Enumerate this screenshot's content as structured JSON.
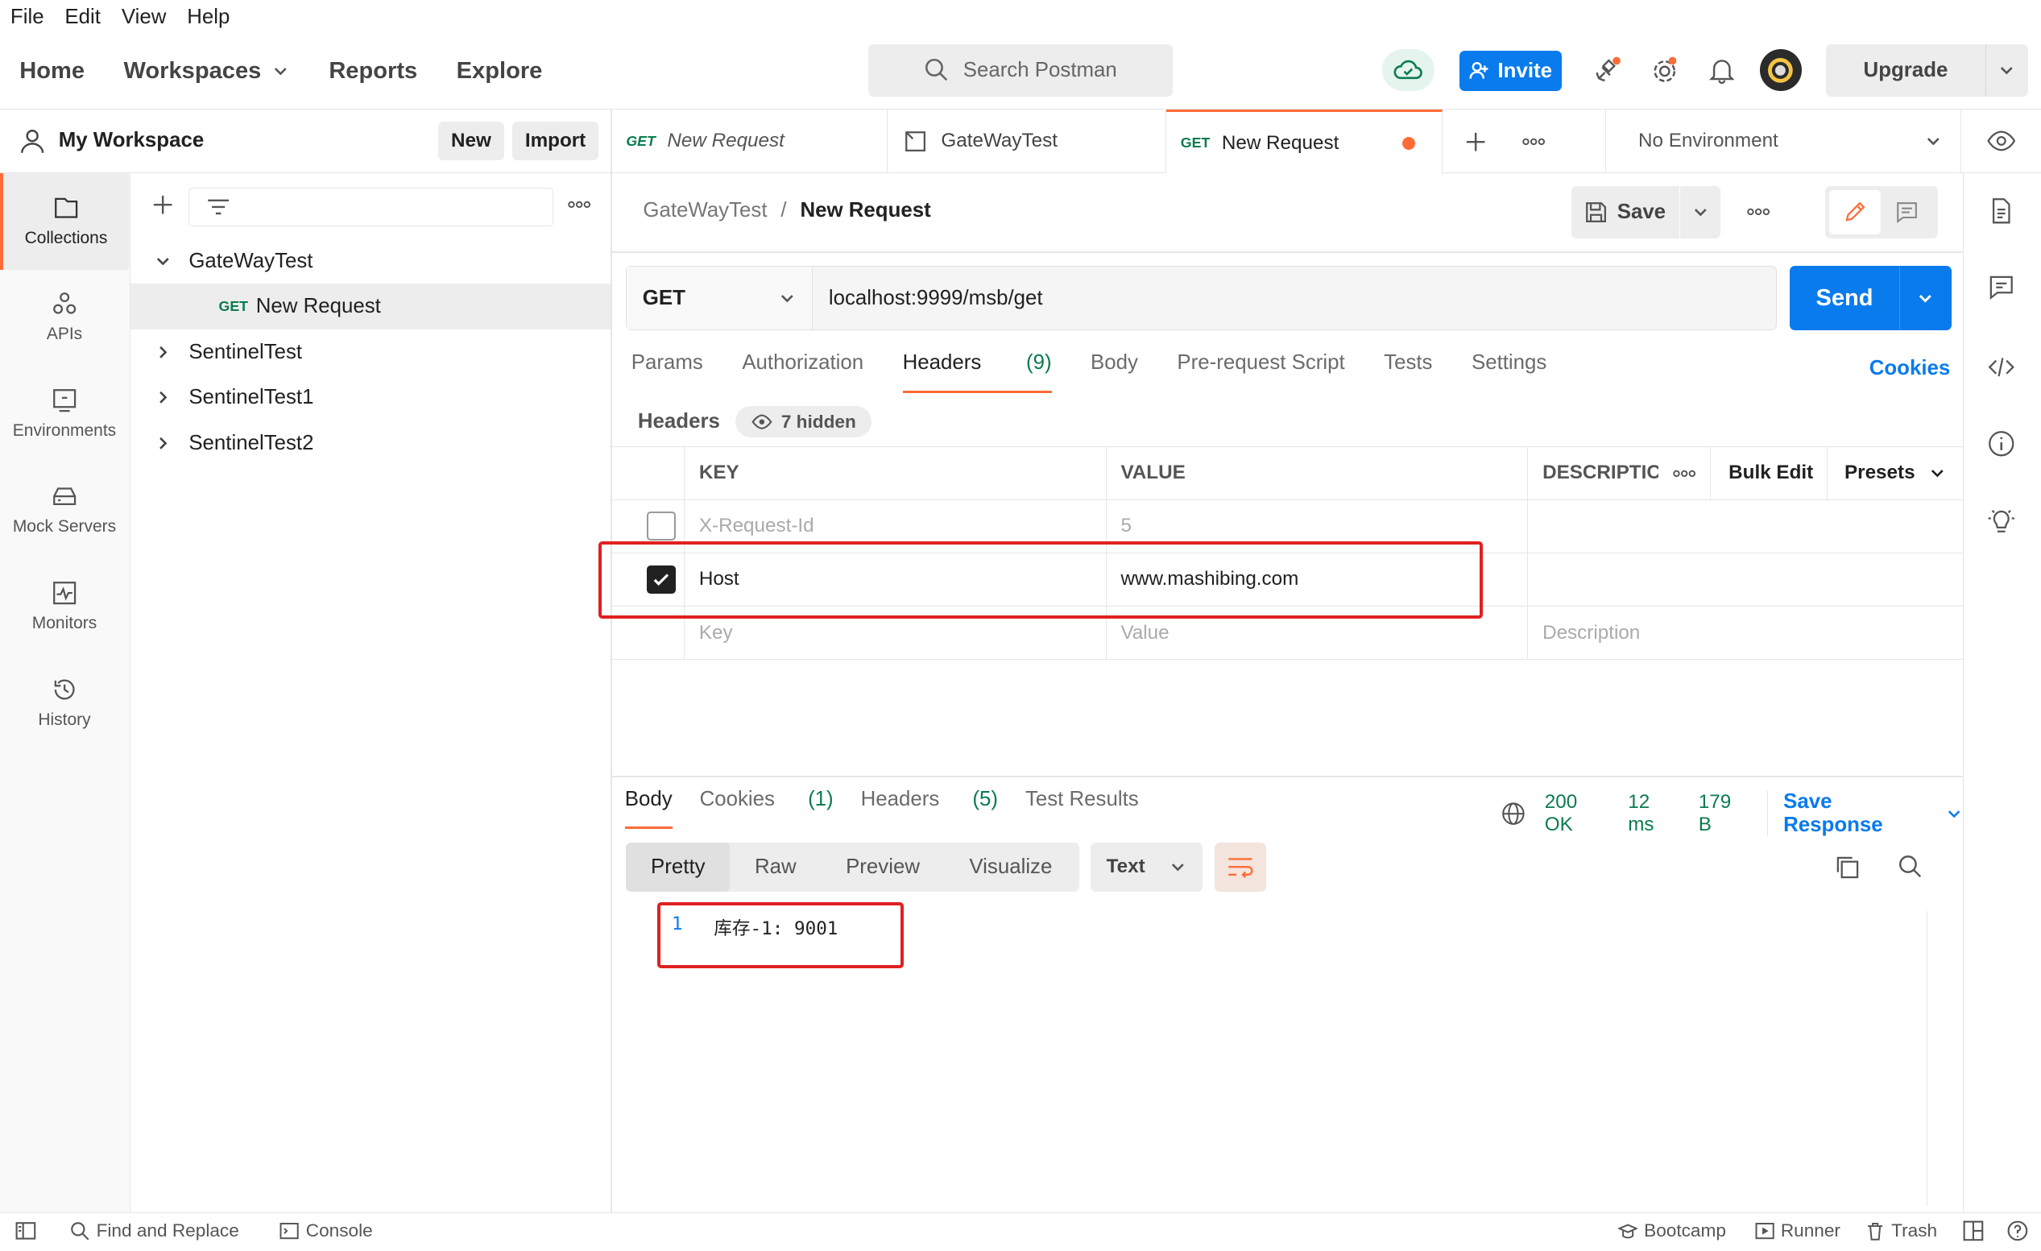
{
  "menu": [
    "File",
    "Edit",
    "View",
    "Help"
  ],
  "nav": {
    "home": "Home",
    "workspaces": "Workspaces",
    "reports": "Reports",
    "explore": "Explore"
  },
  "search": {
    "placeholder": "Search Postman"
  },
  "header": {
    "invite": "Invite",
    "upgrade": "Upgrade"
  },
  "workspace": {
    "name": "My Workspace",
    "new": "New",
    "import": "Import"
  },
  "rail": [
    {
      "label": "Collections",
      "icon": "collections-icon"
    },
    {
      "label": "APIs",
      "icon": "apis-icon"
    },
    {
      "label": "Environments",
      "icon": "environments-icon"
    },
    {
      "label": "Mock Servers",
      "icon": "mock-servers-icon"
    },
    {
      "label": "Monitors",
      "icon": "monitors-icon"
    },
    {
      "label": "History",
      "icon": "history-icon"
    }
  ],
  "tree": {
    "collections": [
      "GateWayTest",
      "SentinelTest",
      "SentinelTest1",
      "SentinelTest2"
    ],
    "child": {
      "method": "GET",
      "name": "New Request"
    }
  },
  "tabs": [
    {
      "method": "GET",
      "name": "New Request"
    },
    {
      "name": "GateWayTest"
    },
    {
      "method": "GET",
      "name": "New Request"
    }
  ],
  "environment": "No Environment",
  "breadcrumb": {
    "parent": "GateWayTest",
    "sep": "/",
    "current": "New Request"
  },
  "actions": {
    "save": "Save"
  },
  "request": {
    "method": "GET",
    "url": "localhost:9999/msb/get",
    "send": "Send"
  },
  "reqtabs": {
    "params": "Params",
    "authorization": "Authorization",
    "headers": "Headers",
    "headers_count": "(9)",
    "body": "Body",
    "prerequest": "Pre-request Script",
    "tests": "Tests",
    "settings": "Settings",
    "cookies": "Cookies"
  },
  "headers_section": {
    "title": "Headers",
    "hidden": "7 hidden"
  },
  "table": {
    "cols": {
      "key": "KEY",
      "value": "VALUE",
      "description": "DESCRIPTIC",
      "bulk": "Bulk Edit",
      "presets": "Presets"
    },
    "rows": [
      {
        "key": "X-Request-Id",
        "value": "5",
        "checked": false
      },
      {
        "key": "Host",
        "value": "www.mashibing.com",
        "checked": true
      }
    ],
    "placeholder": {
      "key": "Key",
      "value": "Value",
      "description": "Description"
    }
  },
  "response": {
    "tabs": {
      "body": "Body",
      "cookies": "Cookies",
      "cookies_count": "(1)",
      "headers": "Headers",
      "headers_count": "(5)",
      "tests": "Test Results"
    },
    "status": "200 OK",
    "time": "12 ms",
    "size": "179 B",
    "save": "Save Response",
    "formats": [
      "Pretty",
      "Raw",
      "Preview",
      "Visualize"
    ],
    "type": "Text",
    "line_no": "1",
    "line_text": "库存-1: 9001"
  },
  "footer": {
    "find": "Find and Replace",
    "console": "Console",
    "bootcamp": "Bootcamp",
    "runner": "Runner",
    "trash": "Trash"
  },
  "colors": {
    "accent": "#097bed",
    "orange": "#ff6c37",
    "green": "#0a7c4d",
    "red_box": "#e02020"
  }
}
